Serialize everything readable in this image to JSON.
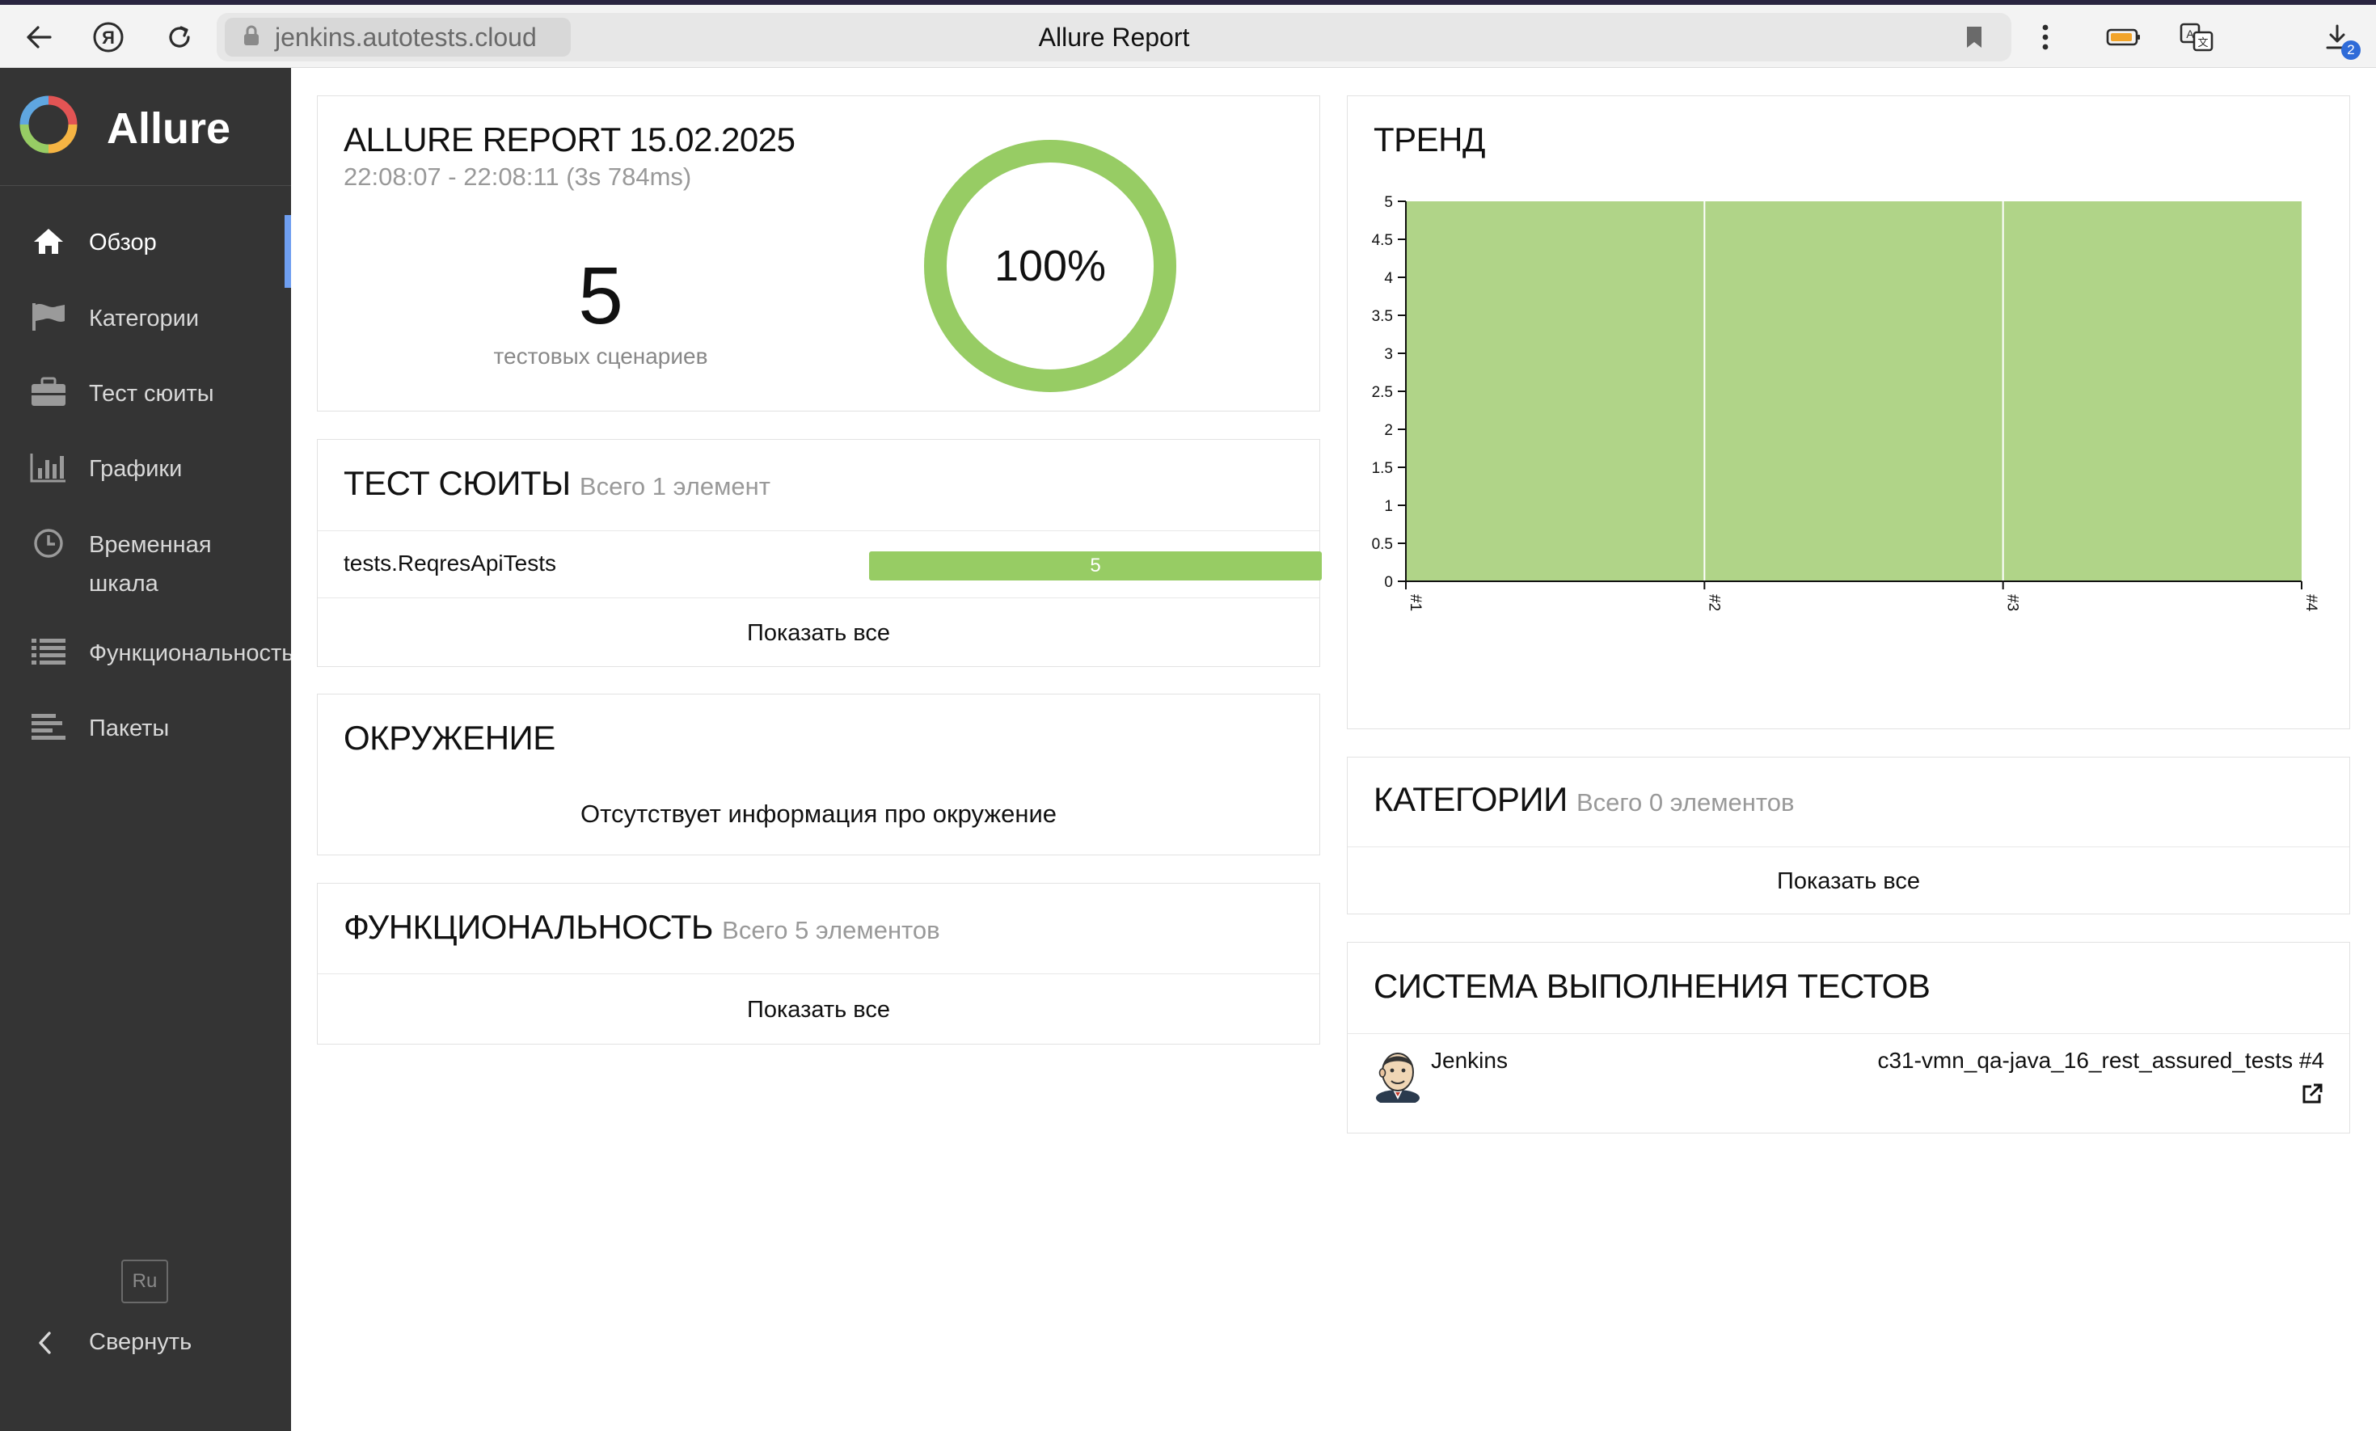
{
  "browser": {
    "url": "jenkins.autotests.cloud",
    "page_title": "Allure Report",
    "downloads_badge": "2"
  },
  "sidebar": {
    "brand": "Allure",
    "items": [
      {
        "label": "Обзор",
        "icon": "home-icon",
        "active": true
      },
      {
        "label": "Категории",
        "icon": "flag-icon"
      },
      {
        "label": "Тест сюиты",
        "icon": "briefcase-icon"
      },
      {
        "label": "Графики",
        "icon": "bar-chart-icon"
      },
      {
        "label": "Временная",
        "label2": "шкала",
        "icon": "clock-icon"
      },
      {
        "label": "Функциональность",
        "icon": "list-icon"
      },
      {
        "label": "Пакеты",
        "icon": "packages-icon"
      }
    ],
    "lang": "Ru",
    "collapse_label": "Свернуть"
  },
  "summary": {
    "title": "ALLURE REPORT 15.02.2025",
    "time_range": "22:08:07 - 22:08:11 (3s 784ms)",
    "test_count": "5",
    "test_count_label": "тестовых сценариев",
    "pass_rate_text": "100%",
    "pass_rate": 1.0,
    "pass_color": "#97cc64"
  },
  "suites": {
    "title": "ТЕСТ СЮИТЫ",
    "subtitle": "Всего 1 элемент",
    "rows": [
      {
        "name": "tests.ReqresApiTests",
        "count": "5",
        "passed_fraction": 1.0
      }
    ],
    "show_all": "Показать все"
  },
  "environment": {
    "title": "ОКРУЖЕНИЕ",
    "message": "Отсутствует информация про окружение"
  },
  "features": {
    "title": "ФУНКЦИОНАЛЬНОСТЬ",
    "subtitle": "Всего 5 элементов",
    "show_all": "Показать все"
  },
  "trend": {
    "title": "ТРЕНД"
  },
  "categories": {
    "title": "КАТЕГОРИИ",
    "subtitle": "Всего 0 элементов",
    "show_all": "Показать все"
  },
  "executors": {
    "title": "СИСТЕМА ВЫПОЛНЕНИЯ ТЕСТОВ",
    "name": "Jenkins",
    "build": "c31-vmn_qa-java_16_rest_assured_tests #4"
  },
  "chart_data": {
    "type": "area",
    "x": [
      "#1",
      "#2",
      "#3",
      "#4"
    ],
    "series": [
      {
        "values": [
          5,
          5,
          5,
          5
        ],
        "color": "#b0d488"
      }
    ],
    "yticks": [
      "0",
      "0.5",
      "1",
      "1.5",
      "2",
      "2.5",
      "3",
      "3.5",
      "4",
      "4.5",
      "5"
    ],
    "ylim": [
      0,
      5
    ],
    "grid": false
  }
}
